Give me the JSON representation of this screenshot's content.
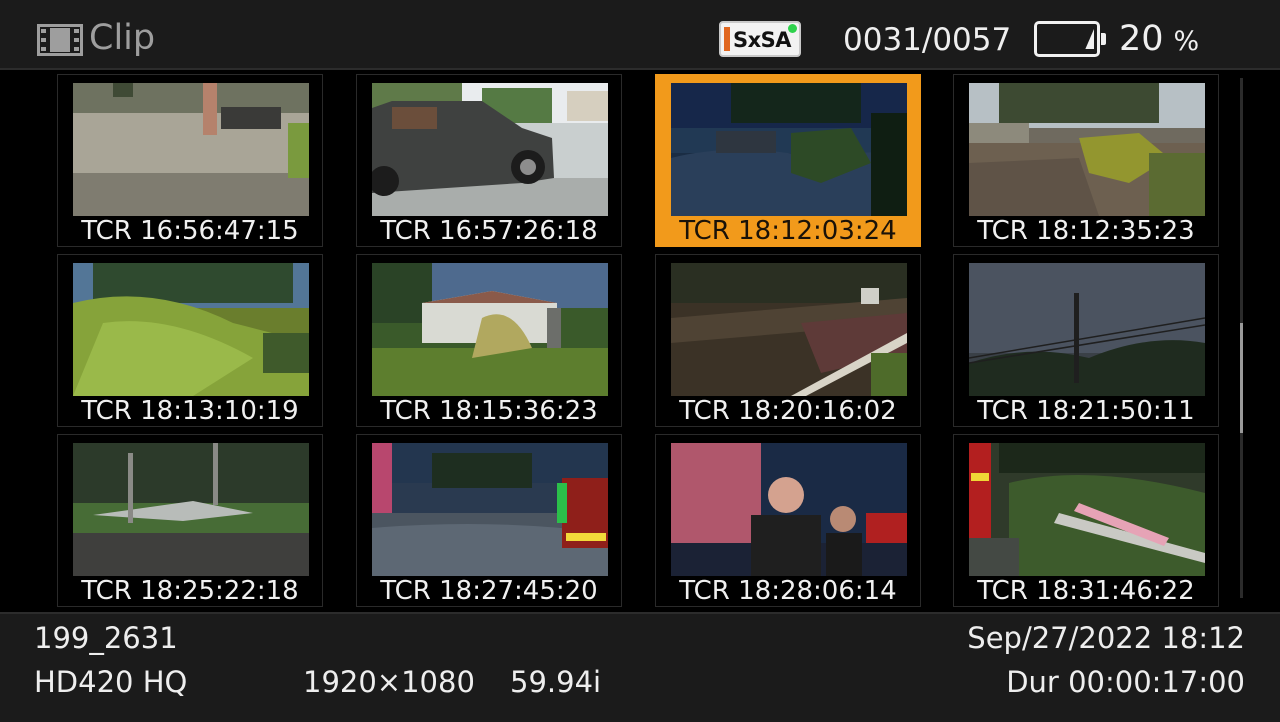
{
  "header": {
    "title": "Clip",
    "icon": "film-clip-icon",
    "media_badge": "SxSA",
    "clip_counter": "0031/0057",
    "battery_percent": "20",
    "battery_unit": "%",
    "battery_level": 0.2
  },
  "thumbnails": [
    {
      "tcr": "TCR 16:56:47:15",
      "selected": false
    },
    {
      "tcr": "TCR 16:57:26:18",
      "selected": false
    },
    {
      "tcr": "TCR 18:12:03:24",
      "selected": true
    },
    {
      "tcr": "TCR 18:12:35:23",
      "selected": false
    },
    {
      "tcr": "TCR 18:13:10:19",
      "selected": false
    },
    {
      "tcr": "TCR 18:15:36:23",
      "selected": false
    },
    {
      "tcr": "TCR 18:20:16:02",
      "selected": false
    },
    {
      "tcr": "TCR 18:21:50:11",
      "selected": false
    },
    {
      "tcr": "TCR 18:25:22:18",
      "selected": false
    },
    {
      "tcr": "TCR 18:27:45:20",
      "selected": false
    },
    {
      "tcr": "TCR 18:28:06:14",
      "selected": false
    },
    {
      "tcr": "TCR 18:31:46:22",
      "selected": false
    }
  ],
  "footer": {
    "clip_name": "199_2631",
    "format": "HD420 HQ",
    "resolution": "1920×1080",
    "frame_rate": "59.94i",
    "datetime": "Sep/27/2022 18:12",
    "duration": "Dur 00:00:17:00"
  },
  "colors": {
    "selection": "#f29a1b",
    "media_badge_stripe": "#e0661e",
    "media_badge_dot": "#2ed24c"
  }
}
